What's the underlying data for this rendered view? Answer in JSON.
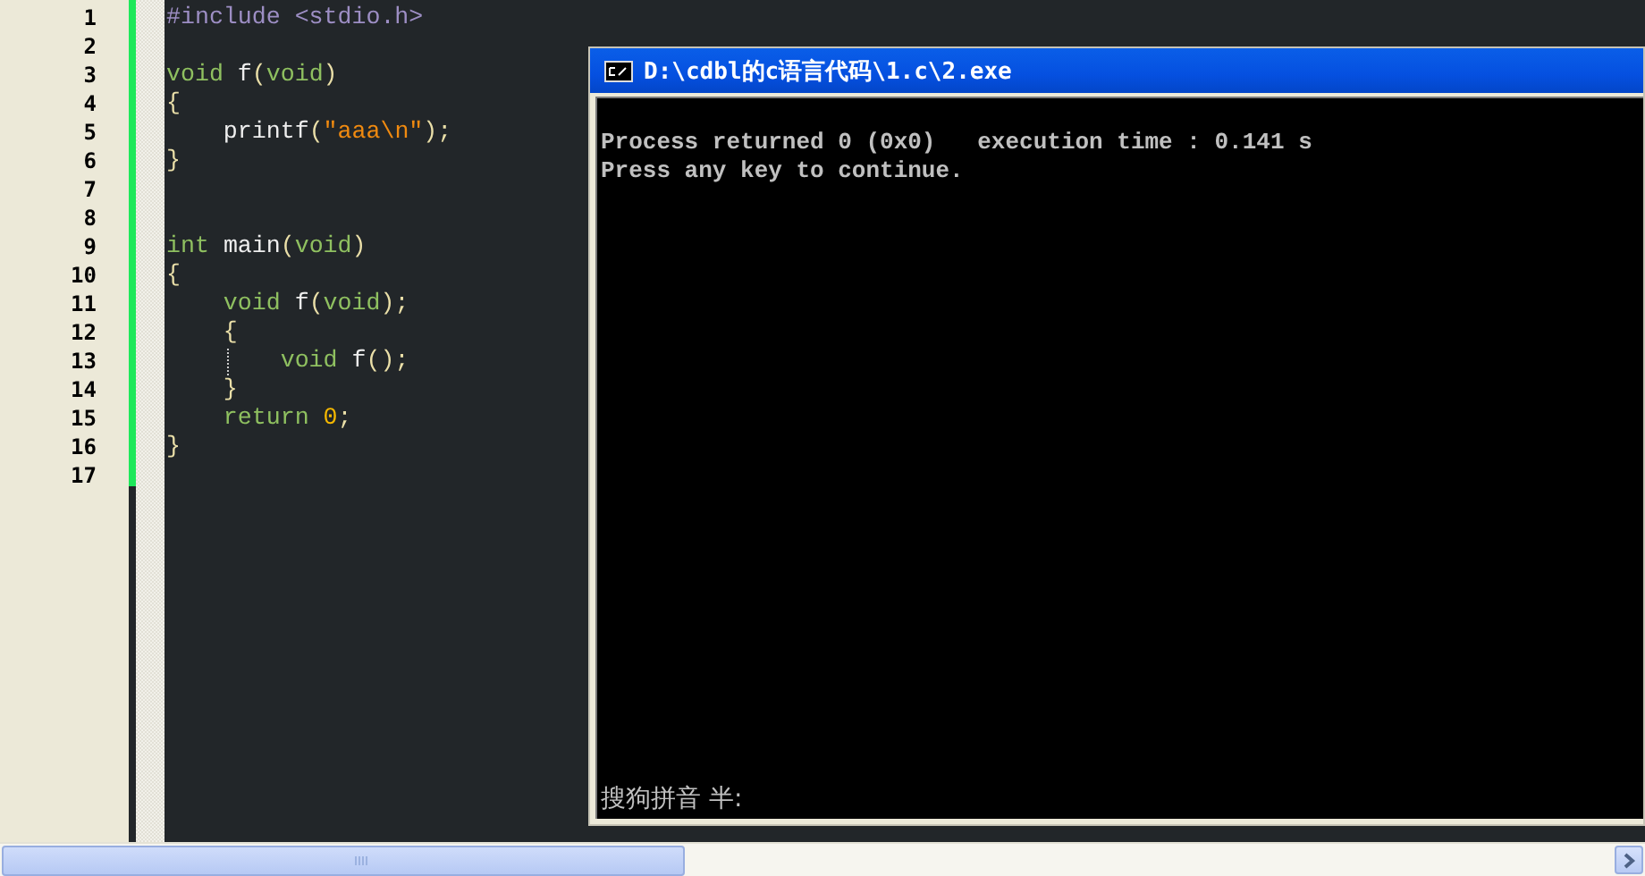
{
  "editor": {
    "lines": [
      {
        "number": "1",
        "tokens": [
          {
            "text": "#include <stdio.h>",
            "kind": "preproc"
          }
        ]
      },
      {
        "number": "2"
      },
      {
        "number": "3",
        "tokens": [
          {
            "text": "void",
            "kind": "keyword"
          },
          {
            "text": " f",
            "kind": "plain"
          },
          {
            "text": "(",
            "kind": "brace"
          },
          {
            "text": "void",
            "kind": "keyword"
          },
          {
            "text": ")",
            "kind": "brace"
          }
        ]
      },
      {
        "number": "4",
        "tokens": [
          {
            "text": "{",
            "kind": "brace"
          }
        ]
      },
      {
        "number": "5",
        "tokens": [
          {
            "text": "    printf",
            "kind": "plain"
          },
          {
            "text": "(",
            "kind": "brace"
          },
          {
            "text": "\"aaa\\n\"",
            "kind": "string"
          },
          {
            "text": ");",
            "kind": "brace"
          }
        ]
      },
      {
        "number": "6",
        "tokens": [
          {
            "text": "}",
            "kind": "brace"
          }
        ]
      },
      {
        "number": "7"
      },
      {
        "number": "8"
      },
      {
        "number": "9",
        "tokens": [
          {
            "text": "int",
            "kind": "keyword"
          },
          {
            "text": " main",
            "kind": "plain"
          },
          {
            "text": "(",
            "kind": "brace"
          },
          {
            "text": "void",
            "kind": "keyword"
          },
          {
            "text": ")",
            "kind": "brace"
          }
        ]
      },
      {
        "number": "10",
        "tokens": [
          {
            "text": "{",
            "kind": "brace"
          }
        ]
      },
      {
        "number": "11",
        "tokens": [
          {
            "text": "    void",
            "kind": "keyword"
          },
          {
            "text": " f",
            "kind": "plain"
          },
          {
            "text": "(",
            "kind": "brace"
          },
          {
            "text": "void",
            "kind": "keyword"
          },
          {
            "text": ");",
            "kind": "brace"
          }
        ]
      },
      {
        "number": "12",
        "tokens": [
          {
            "text": "    {",
            "kind": "brace"
          }
        ]
      },
      {
        "number": "13",
        "tokens": [
          {
            "text": "        void",
            "kind": "keyword"
          },
          {
            "text": " f",
            "kind": "plain"
          },
          {
            "text": "();",
            "kind": "brace"
          }
        ]
      },
      {
        "number": "14",
        "tokens": [
          {
            "text": "    }",
            "kind": "brace"
          }
        ]
      },
      {
        "number": "15",
        "tokens": [
          {
            "text": "    return ",
            "kind": "keyword"
          },
          {
            "text": "0",
            "kind": "number"
          },
          {
            "text": ";",
            "kind": "brace"
          }
        ]
      },
      {
        "number": "16",
        "tokens": [
          {
            "text": "}",
            "kind": "brace"
          }
        ]
      },
      {
        "number": "17"
      }
    ]
  },
  "console": {
    "title": "D:\\cdbl的c语言代码\\1.c\\2.exe",
    "lines": [
      "Process returned 0 (0x0)   execution time : 0.141 s",
      "Press any key to continue."
    ],
    "ime_status": "搜狗拼音 半:"
  }
}
